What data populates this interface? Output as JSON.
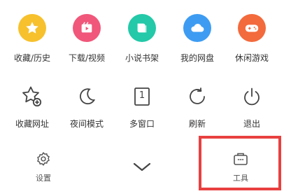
{
  "menu": {
    "row1": [
      {
        "label": "收藏/历史",
        "icon": "star-icon",
        "color": "#f7c12d"
      },
      {
        "label": "下载/视频",
        "icon": "download-video-icon",
        "color": "#f0577a"
      },
      {
        "label": "小说书架",
        "icon": "book-icon",
        "color": "#23c9a8"
      },
      {
        "label": "我的网盘",
        "icon": "cloud-icon",
        "color": "#3d9cf2"
      },
      {
        "label": "休闲游戏",
        "icon": "gamepad-icon",
        "color": "#f36a3c"
      }
    ],
    "row2": [
      {
        "label": "收藏网址",
        "icon": "star-add-icon"
      },
      {
        "label": "夜间模式",
        "icon": "moon-icon"
      },
      {
        "label": "多窗口",
        "icon": "window-count-icon",
        "count": "1"
      },
      {
        "label": "刷新",
        "icon": "refresh-icon"
      },
      {
        "label": "退出",
        "icon": "power-icon"
      }
    ]
  },
  "bottom": {
    "settings_label": "设置",
    "tools_label": "工具"
  },
  "colors": {
    "highlight": "#e8403f",
    "icon_stroke": "#444444"
  }
}
